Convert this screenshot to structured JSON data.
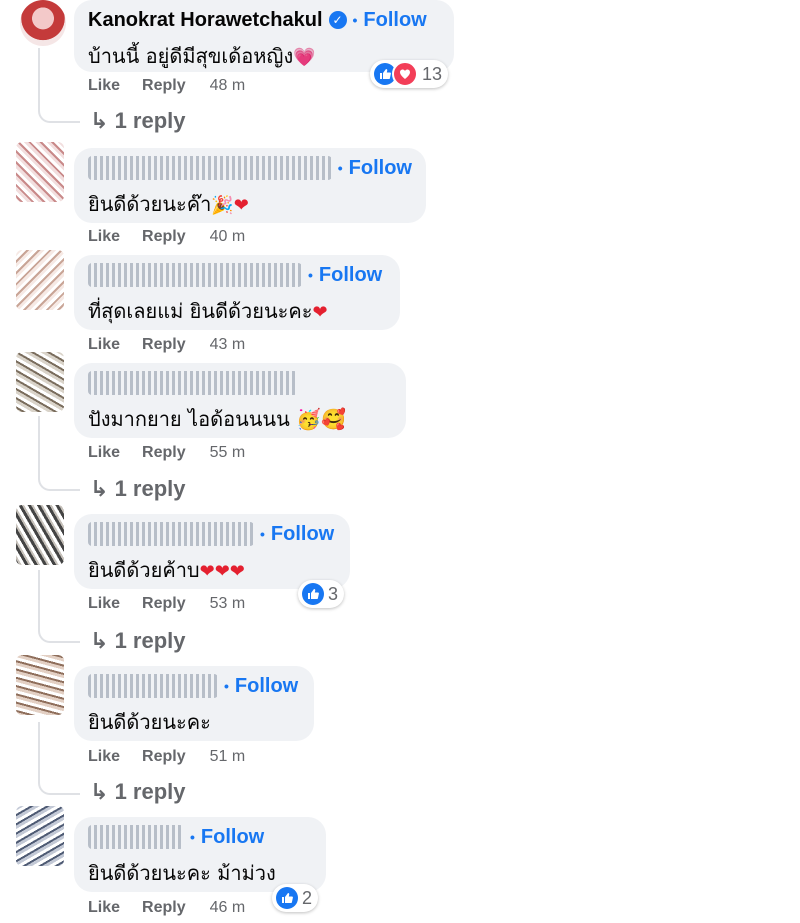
{
  "follow_label": "Follow",
  "like_label": "Like",
  "reply_label": "Reply",
  "reply_count_label": "1 reply",
  "colors": {
    "link": "#1877f2",
    "bubble": "#f0f2f5",
    "meta": "#65676b"
  },
  "comments": [
    {
      "name": "Kanokrat Horawetchakul",
      "verified": true,
      "text": "บ้านนี้ อยู่ดีมีสุขเด้อหญิง",
      "emoji": "💗",
      "time": "48 m",
      "reactions": "13",
      "has_reply": true
    },
    {
      "name": "",
      "text": "ยินดีด้วยนะค๊า",
      "emoji": "🎉❤",
      "time": "40 m"
    },
    {
      "name": "",
      "text": "ที่สุดเลยแม่ ยินดีด้วยนะคะ",
      "emoji": "❤",
      "time": "43 m"
    },
    {
      "name": "",
      "text": "ปังมากยาย ไอด้อนนนน",
      "emoji": "🥳🥰",
      "time": "55 m",
      "has_reply": true
    },
    {
      "name": "",
      "text": "ยินดีด้วยค้าบ",
      "emoji": "❤❤❤",
      "time": "53 m",
      "reactions": "3",
      "has_reply": true
    },
    {
      "name": "",
      "text": "ยินดีด้วยนะคะ",
      "time": "51 m",
      "has_reply": true
    },
    {
      "name": "",
      "text": "ยินดีด้วยนะคะ ม้าม่วง",
      "time": "46 m",
      "reactions": "2"
    }
  ]
}
